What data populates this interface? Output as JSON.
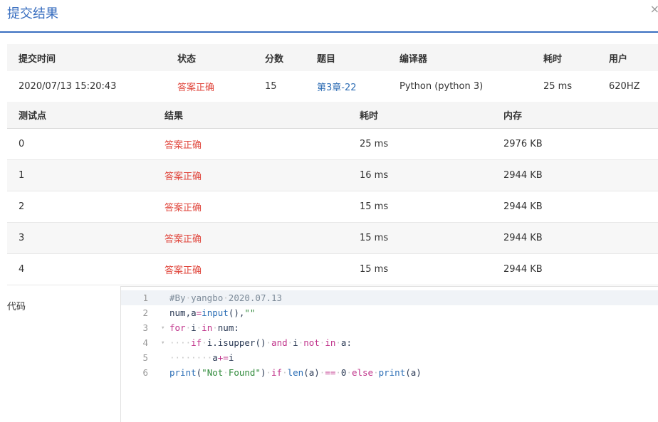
{
  "header": {
    "title": "提交结果",
    "close": "×"
  },
  "summary": {
    "headers": [
      "提交时间",
      "状态",
      "分数",
      "题目",
      "编译器",
      "耗时",
      "用户"
    ],
    "row": {
      "time": "2020/07/13 15:20:43",
      "status": "答案正确",
      "score": "15",
      "problem": "第3章-22",
      "compiler": "Python (python 3)",
      "elapsed": "25 ms",
      "user": "620HZ"
    }
  },
  "tests": {
    "headers": [
      "测试点",
      "结果",
      "耗时",
      "内存"
    ],
    "rows": [
      {
        "id": "0",
        "result": "答案正确",
        "time": "25 ms",
        "memory": "2976 KB"
      },
      {
        "id": "1",
        "result": "答案正确",
        "time": "16 ms",
        "memory": "2944 KB"
      },
      {
        "id": "2",
        "result": "答案正确",
        "time": "15 ms",
        "memory": "2944 KB"
      },
      {
        "id": "3",
        "result": "答案正确",
        "time": "15 ms",
        "memory": "2944 KB"
      },
      {
        "id": "4",
        "result": "答案正确",
        "time": "15 ms",
        "memory": "2944 KB"
      }
    ]
  },
  "code": {
    "label": "代码",
    "lines": [
      {
        "num": "1",
        "fold": "",
        "text": "#By yangbo 2020.07.13"
      },
      {
        "num": "2",
        "fold": "",
        "text": "num,a=input(),\"\""
      },
      {
        "num": "3",
        "fold": "▾",
        "text": "for i in num:"
      },
      {
        "num": "4",
        "fold": "▾",
        "text": "    if i.isupper() and i not in a:"
      },
      {
        "num": "5",
        "fold": "",
        "text": "        a+=i"
      },
      {
        "num": "6",
        "fold": "",
        "text": "print(\"Not Found\") if len(a) == 0 else print(a)"
      }
    ]
  },
  "colors": {
    "accent": "#3a6fc0",
    "success": "#e0463c",
    "link": "#2e6db4"
  }
}
